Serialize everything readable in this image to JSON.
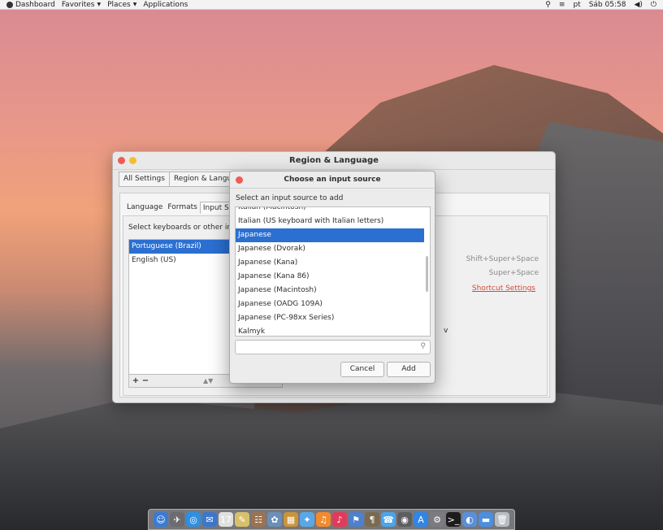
{
  "topbar": {
    "items": [
      "Dashboard",
      "Favorites",
      "Places",
      "Applications"
    ],
    "lang": "pt",
    "clock": "Sáb 05:58"
  },
  "region_window": {
    "title": "Region & Language",
    "crumbs": [
      "All Settings",
      "Region & Language"
    ],
    "tabs": [
      "Language",
      "Formats",
      "Input Sou"
    ],
    "label": "Select keyboards or other inpu",
    "sources": [
      "Portuguese (Brazil)",
      "English (US)"
    ],
    "shortcuts": [
      "Shift+Super+Space",
      "Super+Space"
    ],
    "shortcut_settings": "Shortcut Settings",
    "stray_text": "v"
  },
  "dialog": {
    "title": "Choose an input source",
    "subtitle": "Select an input source to add",
    "languages": [
      "Italian (Macintosh)",
      "Italian (US keyboard with Italian letters)",
      "Japanese",
      "Japanese (Dvorak)",
      "Japanese (Kana)",
      "Japanese (Kana 86)",
      "Japanese (Macintosh)",
      "Japanese (OADG 109A)",
      "Japanese (PC-98xx Series)",
      "Kalmyk"
    ],
    "selected_index": 2,
    "search_placeholder": "",
    "cancel_label": "Cancel",
    "add_label": "Add"
  },
  "dock": {
    "icons": [
      {
        "name": "finder-icon",
        "color": "#3a7bd5",
        "glyph": "☺"
      },
      {
        "name": "launchpad-icon",
        "color": "#6c6c70",
        "glyph": "✈"
      },
      {
        "name": "safari-icon",
        "color": "#2f8fe0",
        "glyph": "◎"
      },
      {
        "name": "mail-icon",
        "color": "#3d77c9",
        "glyph": "✉"
      },
      {
        "name": "calendar-icon",
        "color": "#e0e0e0",
        "glyph": "17"
      },
      {
        "name": "notes-icon",
        "color": "#d8c06a",
        "glyph": "✎"
      },
      {
        "name": "contacts-icon",
        "color": "#9b7350",
        "glyph": "☷"
      },
      {
        "name": "photos-icon",
        "color": "#6a8fb8",
        "glyph": "✿"
      },
      {
        "name": "preview-icon",
        "color": "#c9953a",
        "glyph": "▦"
      },
      {
        "name": "messages-icon",
        "color": "#5aa7e8",
        "glyph": "✦"
      },
      {
        "name": "itunes-icon",
        "color": "#f28a2e",
        "glyph": "♫"
      },
      {
        "name": "music-icon",
        "color": "#e23b5a",
        "glyph": "♪"
      },
      {
        "name": "maps-icon",
        "color": "#4f7fcf",
        "glyph": "⚑"
      },
      {
        "name": "textedit-icon",
        "color": "#7a6a50",
        "glyph": "¶"
      },
      {
        "name": "facetime-icon",
        "color": "#4aa5ea",
        "glyph": "☎"
      },
      {
        "name": "chrome-icon",
        "color": "#5e5e60",
        "glyph": "◉"
      },
      {
        "name": "appstore-icon",
        "color": "#2f86e6",
        "glyph": "A"
      },
      {
        "name": "settings-icon",
        "color": "#7c7c80",
        "glyph": "⚙"
      },
      {
        "name": "terminal-icon",
        "color": "#1c1c1c",
        "glyph": ">_"
      },
      {
        "name": "preferences-icon",
        "color": "#5b8fd6",
        "glyph": "◐"
      },
      {
        "name": "folder-icon",
        "color": "#4c8ee0",
        "glyph": "▬"
      },
      {
        "name": "trash-icon",
        "color": "#b9bcc2",
        "glyph": "🗑"
      }
    ]
  }
}
